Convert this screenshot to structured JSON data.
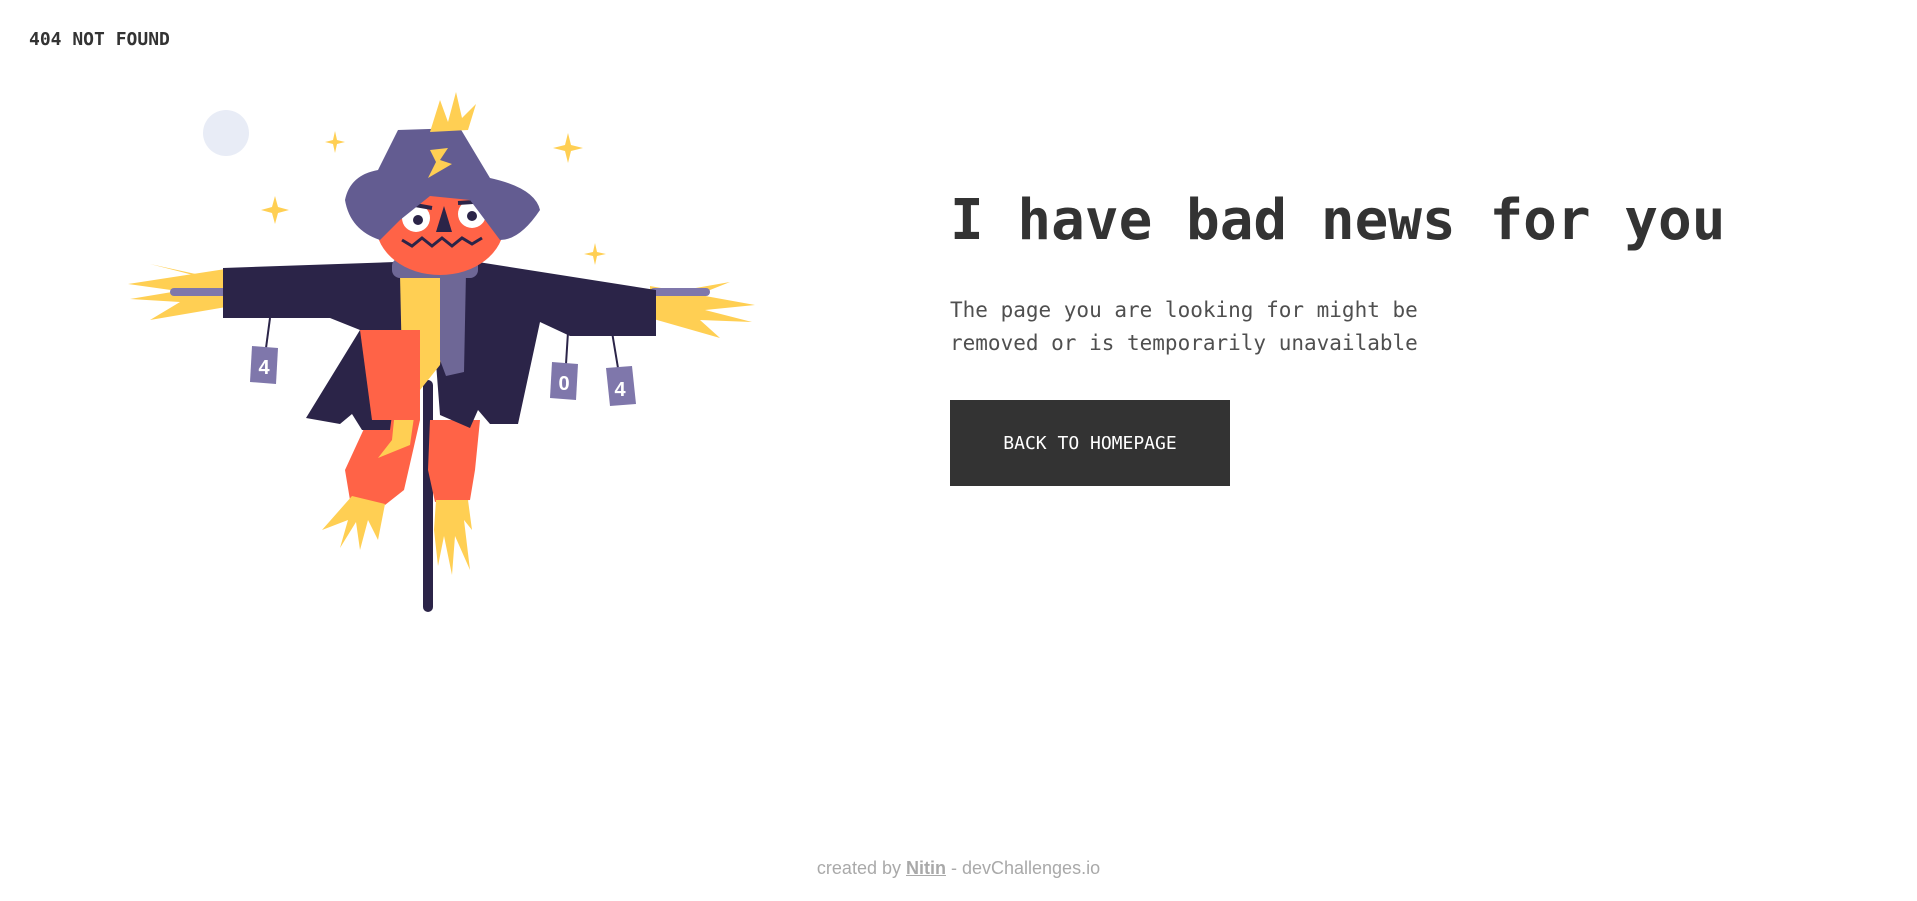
{
  "header": {
    "brand_text": "404 NOT FOUND"
  },
  "illustration": {
    "name": "scarecrow",
    "can_labels": [
      "4",
      "0",
      "4"
    ],
    "colors": {
      "hat": "#635C91",
      "coat": "#2B2448",
      "scarf": "#6E6796",
      "face": "#FF6347",
      "straw": "#FFCF53",
      "cans": "#7F77AB",
      "moon": "#E8ECF6",
      "pole": "#2B2448"
    }
  },
  "main": {
    "headline": "I have bad news for you",
    "message": "The page you are looking for might be removed or is temporarily unavailable",
    "button_label": "BACK TO HOMEPAGE"
  },
  "footer": {
    "prefix": "created by ",
    "author": "Nitin",
    "suffix": " - devChallenges.io"
  },
  "colors": {
    "text_dark": "#333333",
    "button_bg": "#333333",
    "button_text": "#FFFFFF",
    "footer_text": "#A9A9A9"
  }
}
